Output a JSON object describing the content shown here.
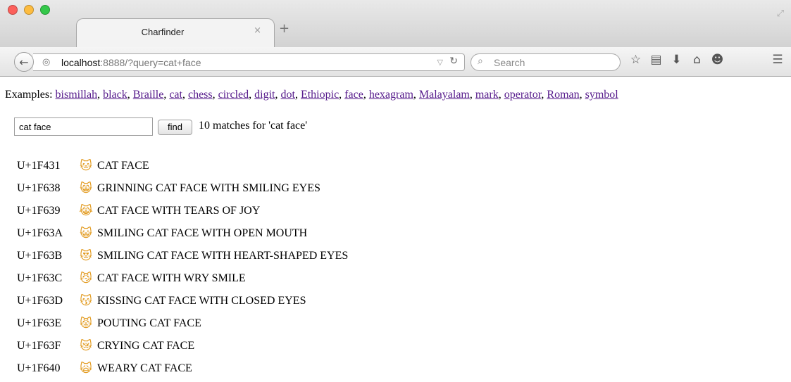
{
  "browser": {
    "tab_title": "Charfinder",
    "tab_close": "×",
    "new_tab": "+",
    "url_host": "localhost",
    "url_rest": ":8888/?query=cat+face",
    "search_placeholder": "Search",
    "icons": [
      "back-arrow",
      "globe",
      "dropdown-arrow",
      "reload",
      "search",
      "star-bookmark",
      "reading-list",
      "download",
      "home",
      "chat",
      "hamburger-menu"
    ]
  },
  "page": {
    "examples_label": "Examples:",
    "examples": [
      "bismillah",
      "black",
      "Braille",
      "cat",
      "chess",
      "circled",
      "digit",
      "dot",
      "Ethiopic",
      "face",
      "hexagram",
      "Malayalam",
      "mark",
      "operator",
      "Roman",
      "symbol"
    ],
    "query_value": "cat face",
    "find_label": "find",
    "result_message": "10 matches for 'cat face'",
    "results": [
      {
        "code": "U+1F431",
        "char": "🐱",
        "name": "CAT FACE"
      },
      {
        "code": "U+1F638",
        "char": "😸",
        "name": "GRINNING CAT FACE WITH SMILING EYES"
      },
      {
        "code": "U+1F639",
        "char": "😹",
        "name": "CAT FACE WITH TEARS OF JOY"
      },
      {
        "code": "U+1F63A",
        "char": "😺",
        "name": "SMILING CAT FACE WITH OPEN MOUTH"
      },
      {
        "code": "U+1F63B",
        "char": "😻",
        "name": "SMILING CAT FACE WITH HEART-SHAPED EYES"
      },
      {
        "code": "U+1F63C",
        "char": "😼",
        "name": "CAT FACE WITH WRY SMILE"
      },
      {
        "code": "U+1F63D",
        "char": "😽",
        "name": "KISSING CAT FACE WITH CLOSED EYES"
      },
      {
        "code": "U+1F63E",
        "char": "😾",
        "name": "POUTING CAT FACE"
      },
      {
        "code": "U+1F63F",
        "char": "😿",
        "name": "CRYING CAT FACE"
      },
      {
        "code": "U+1F640",
        "char": "🙀",
        "name": "WEARY CAT FACE"
      }
    ]
  },
  "colors": {
    "link_visited": "#551a8b",
    "emoji_tint": "#e29a1e"
  }
}
